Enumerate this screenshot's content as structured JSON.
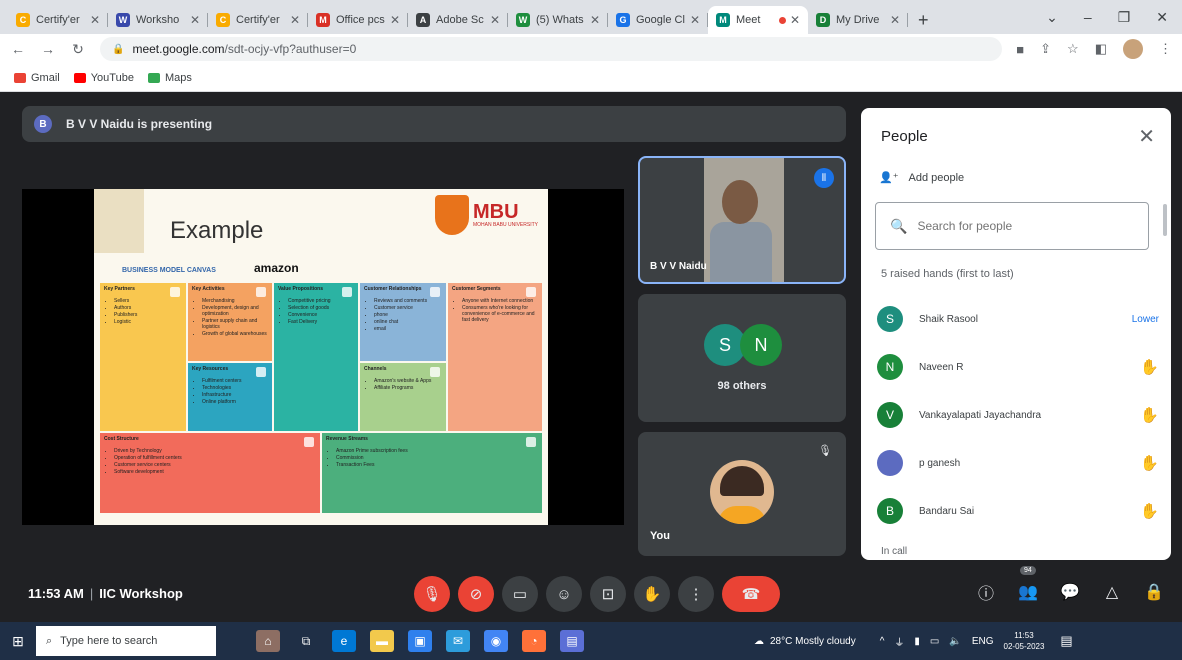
{
  "browser": {
    "tabs": [
      {
        "label": "Certify'er",
        "color": "#f9ab00",
        "icon": "C"
      },
      {
        "label": "Worksho",
        "color": "#3949ab",
        "icon": "W"
      },
      {
        "label": "Certify'er",
        "color": "#f9ab00",
        "icon": "C"
      },
      {
        "label": "Office pcs",
        "color": "#d93025",
        "icon": "M"
      },
      {
        "label": "Adobe Sc",
        "color": "#3c4043",
        "icon": "A"
      },
      {
        "label": "(5) Whats",
        "color": "#1e8e3e",
        "icon": "W"
      },
      {
        "label": "Google Cl",
        "color": "#1a73e8",
        "icon": "G"
      },
      {
        "label": "Meet",
        "color": "#00897b",
        "icon": "M",
        "active": true
      },
      {
        "label": "My Drive",
        "color": "#188038",
        "icon": "D"
      }
    ],
    "new_tab": "+",
    "url_domain": "meet.google.com",
    "url_path": "/sdt-ocjy-vfp?authuser=0",
    "bookmarks": [
      {
        "label": "Gmail",
        "color": "#ea4335"
      },
      {
        "label": "YouTube",
        "color": "#ff0000"
      },
      {
        "label": "Maps",
        "color": "#34a853"
      }
    ]
  },
  "meet": {
    "presenter_banner": "B V V Naidu is presenting",
    "presenter_initial": "B",
    "slide": {
      "title": "Example",
      "logo_text": "MBU",
      "logo_sub": "MOHAN BABU UNIVERSITY",
      "canvas_label": "BUSINESS MODEL CANVAS",
      "brand": "amazon",
      "blocks": [
        {
          "heading": "Key Partners",
          "items": [
            "Sellers",
            "Authors",
            "Publishers",
            "Logistic"
          ],
          "color": "#f9c74f"
        },
        {
          "heading": "Key Activities",
          "items": [
            "Merchandising",
            "Development, design and optimization",
            "Partner supply chain and logistics",
            "Growth of global warehouses"
          ],
          "color": "#f4a261"
        },
        {
          "heading": "Value Propositions",
          "items": [
            "Competitive pricing",
            "Selection of goods",
            "Convenience",
            "Fast Delivery"
          ],
          "color": "#2bb3a3"
        },
        {
          "heading": "Customer Relationships",
          "items": [
            "Reviews and comments",
            "Customer service",
            "phone",
            "online chat",
            "email"
          ],
          "color": "#8ab4d8"
        },
        {
          "heading": "Customer Segments",
          "items": [
            "Anyone with Internet connection",
            "Consumers who're looking for convenience of e-commerce and fast delivery"
          ],
          "color": "#f4a582"
        },
        {
          "heading": "Key Resources",
          "items": [
            "Fulfilment centers",
            "Technologies",
            "Infrastructure",
            "Online platform"
          ],
          "color": "#2ca5c0"
        },
        {
          "heading": "Channels",
          "items": [
            "Amazon's website & Apps",
            "Affiliate Programs"
          ],
          "color": "#a8d08d"
        },
        {
          "heading": "Cost Structure",
          "items": [
            "Driven by Technology",
            "Operation of fulfillment centers",
            "Customer service centers",
            "Software development"
          ],
          "color": "#f26b5b"
        },
        {
          "heading": "Revenue Streams",
          "items": [
            "Amazon Prime subscription fees",
            "Commission",
            "Transaction Fees"
          ],
          "color": "#4caf7d"
        }
      ]
    },
    "presenter_tile_name": "B V V Naidu",
    "others": {
      "initials": [
        "S",
        "N"
      ],
      "colors": [
        "#1e8e7e",
        "#1e8e3e"
      ],
      "count_label": "98 others"
    },
    "you_label": "You"
  },
  "people": {
    "title": "People",
    "add_people": "Add people",
    "search_placeholder": "Search for people",
    "raised_hands_label": "5 raised hands (first to last)",
    "list": [
      {
        "name": "Shaik Rasool",
        "initial": "S",
        "color": "#1e8e7e",
        "action": "Lower"
      },
      {
        "name": "Naveen R",
        "initial": "N",
        "color": "#1e8e3e",
        "action": ""
      },
      {
        "name": "Vankayalapati Jayachandra",
        "initial": "V",
        "color": "#188038",
        "action": ""
      },
      {
        "name": "p ganesh",
        "initial": "",
        "color": "#5c6bc0",
        "action": ""
      },
      {
        "name": "Bandaru Sai",
        "initial": "B",
        "color": "#188038",
        "action": ""
      }
    ],
    "in_call_label": "In call"
  },
  "bottom": {
    "time": "11:53 AM",
    "meeting_name": "IIC Workshop",
    "participant_badge": "94"
  },
  "taskbar": {
    "search_placeholder": "Type here to search",
    "weather": "28°C  Mostly cloudy",
    "lang": "ENG",
    "clock_time": "11:53",
    "clock_date": "02-05-2023"
  }
}
